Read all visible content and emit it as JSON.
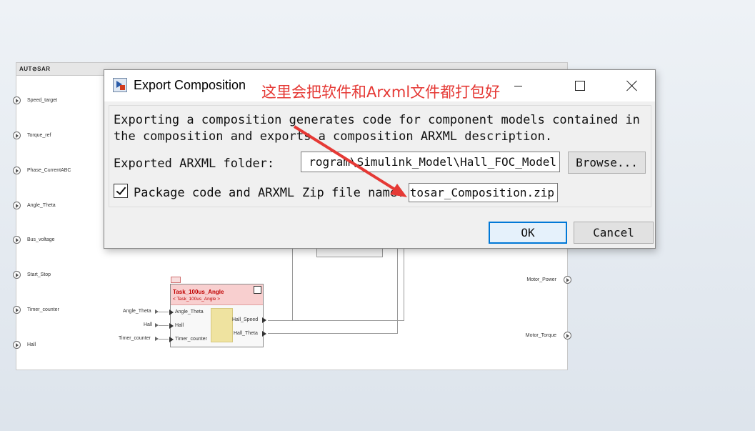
{
  "canvas": {
    "logo": "AUT⊘SAR",
    "inports": [
      "Speed_target",
      "Torque_ref",
      "Phase_CurrentABC",
      "Angle_Theta",
      "Bus_voltage",
      "Start_Stop",
      "Timer_counter",
      "Hall"
    ],
    "outports": [
      "Motor_Power",
      "Motor_Torque"
    ],
    "block": {
      "title": "Task_100us_Angle",
      "subtitle": "< Task_100us_Angle >",
      "inputs": [
        "Angle_Theta",
        "Hall",
        "Timer_counter"
      ],
      "outputs": [
        "Hall_Speed",
        "Hall_Theta"
      ]
    },
    "block_ext_labels": [
      "Angle_Theta",
      "Hall",
      "Timer_counter"
    ]
  },
  "dialog": {
    "title": "Export Composition",
    "annotation": "这里会把软件和Arxml文件都打包好",
    "description_line1": "Exporting a composition generates code for component models contained in",
    "description_line2": "the composition and exports a composition ARXML description.",
    "folder_label": "Exported ARXML folder:",
    "folder_value": "rogram\\Simulink_Model\\Hall_FOC_Model",
    "browse_label": "Browse...",
    "package_label": "Package code and ARXML",
    "package_checked": true,
    "zip_label": "Zip file name:",
    "zip_value": "tosar_Composition.zip",
    "ok_label": "OK",
    "cancel_label": "Cancel"
  },
  "colors": {
    "annotation": "#e53935",
    "block_header": "#f8cfcf",
    "block_title": "#c00000",
    "ok_border": "#0078d7"
  }
}
